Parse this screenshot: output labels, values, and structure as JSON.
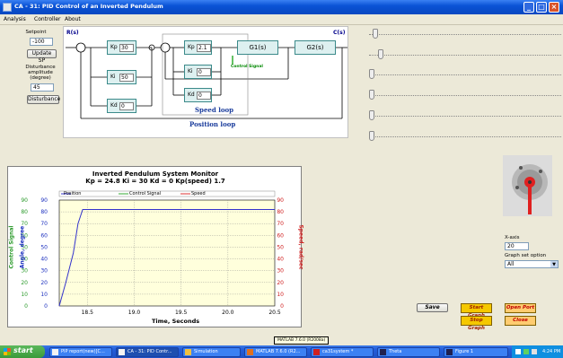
{
  "window": {
    "title": "CA - 31: PID Control of an Inverted Pendulum"
  },
  "menu": [
    "Analysis",
    "Controller",
    "About"
  ],
  "left_panel": {
    "setpoint_label": "Setpoint",
    "setpoint_value": "-100",
    "update_sp": "Update SP",
    "disturbance_label_1": "Disturbance",
    "disturbance_label_2": "amplitude",
    "disturbance_label_3": "(degree)",
    "disturbance_value": "45",
    "disturbance_btn": "Disturbance"
  },
  "diagram": {
    "r_label": "R(s)",
    "c_label": "C(s)",
    "kp1_label": "Kp",
    "kp1_value": "30",
    "ki1_label": "Ki",
    "ki1_value": "50",
    "kd1_label": "Kd",
    "kd1_value": "0",
    "kp2_label": "Kp",
    "kp2_value": "2.1",
    "ki2_label": "Ki",
    "ki2_value": "0",
    "kd2_label": "Kd",
    "kd2_value": "0",
    "g1": "G1(s)",
    "g2": "G2(s)",
    "control_signal": "Control Signal",
    "speed_loop": "Speed loop",
    "position_loop": "Position loop"
  },
  "sliders": [
    0.02,
    0.05,
    0.0,
    0.0,
    0.0,
    0.0
  ],
  "x_axis_box": {
    "label": "X-axis",
    "value": "20",
    "option_label": "Graph set option",
    "option_value": "All"
  },
  "buttons": {
    "save": "Save",
    "start_graph": "Start Graph",
    "stop_graph": "Stop Graph",
    "open_port": "Open Port",
    "close": "Close"
  },
  "tooltip": "MATLAB 7.6.0 (R2008a)",
  "chart_data": {
    "type": "line",
    "title": "Inverted Pendulum System Monitor",
    "subtitle": "Kp = 24.8 Ki = 30 Kd = 0 Kp(speed) 1.7",
    "xlabel": "Time, Seconds",
    "ylabel_left_outer": "Control Signal",
    "ylabel_left_inner": "Angle, degree",
    "ylabel_right": "Speed, rad/sec",
    "xlim": [
      18.2,
      20.5
    ],
    "ylim": [
      0,
      90
    ],
    "x_ticks": [
      "18.5",
      "19.0",
      "19.5",
      "20.0",
      "20.5"
    ],
    "y_ticks": [
      "0",
      "10",
      "20",
      "30",
      "40",
      "50",
      "60",
      "70",
      "80",
      "90"
    ],
    "legend": [
      "Position",
      "Control Signal",
      "Speed"
    ],
    "legend_placement": "top",
    "grid": true,
    "colors": {
      "position": "#3333cc",
      "control": "#33aa33",
      "speed": "#dd3333"
    },
    "series": [
      {
        "name": "Position",
        "x": [
          18.2,
          18.27,
          18.35,
          18.4,
          18.45,
          20.5
        ],
        "values": [
          0,
          20,
          45,
          70,
          82,
          82
        ]
      }
    ]
  },
  "taskbar": {
    "start": "start",
    "tasks": [
      "PIP report(new)[C...",
      "CA - 31: PID Contr...",
      "Simulation",
      "MATLAB 7.6.0 (R2...",
      "ca31system *",
      "Theta",
      "Figure 1"
    ],
    "clock": "4:24 PM"
  }
}
